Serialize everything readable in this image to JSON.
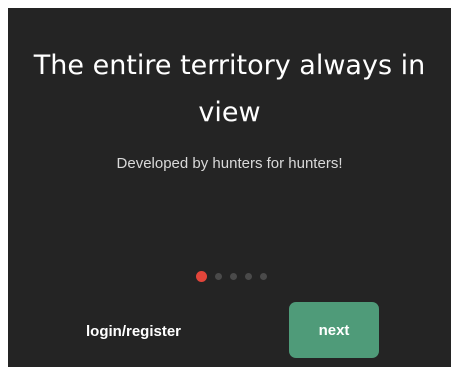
{
  "onboarding": {
    "title": "The entire territory always in view",
    "subtitle": "Developed by hunters for hunters!",
    "pagination": {
      "current": 1,
      "total": 5,
      "active_color": "#e2453a",
      "inactive_color": "#4a4a4a"
    },
    "login_label": "login/register",
    "next_label": "next"
  },
  "colors": {
    "background": "#242424",
    "accent": "#4f9b79"
  }
}
